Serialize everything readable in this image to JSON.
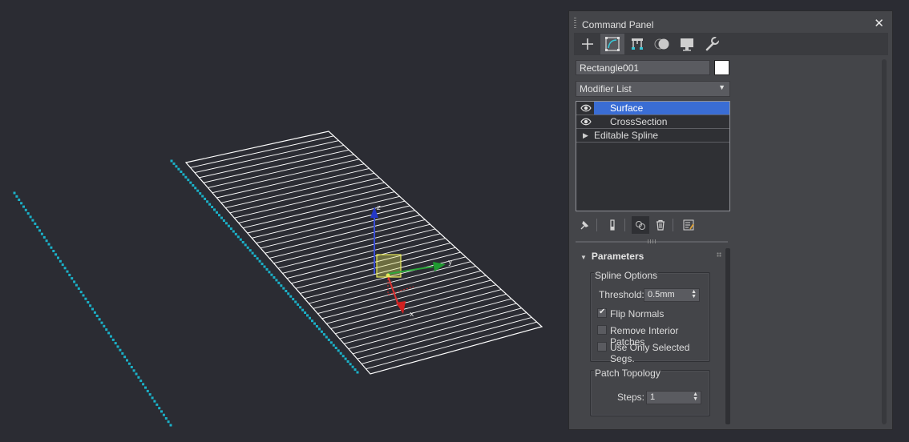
{
  "panel": {
    "title": "Command Panel",
    "close_glyph": "✕",
    "tabs": [
      {
        "name": "create-tab",
        "icon": "plus-icon"
      },
      {
        "name": "modify-tab",
        "icon": "modify-curve-icon",
        "active": true
      },
      {
        "name": "hierarchy-tab",
        "icon": "hierarchy-icon"
      },
      {
        "name": "motion-tab",
        "icon": "motion-sphere-icon"
      },
      {
        "name": "display-tab",
        "icon": "display-monitor-icon"
      },
      {
        "name": "utilities-tab",
        "icon": "wrench-icon"
      }
    ],
    "object_name": "Rectangle001",
    "object_color": "#ffffff",
    "modifier_list_label": "Modifier List",
    "stack": [
      {
        "label": "Surface",
        "visible": true,
        "selected": true
      },
      {
        "label": "CrossSection",
        "visible": true,
        "selected": false
      },
      {
        "label": "Editable Spline",
        "expandable": true,
        "selected": false
      }
    ],
    "stack_tools": [
      "pin-stack-icon",
      "show-end-result-icon",
      "make-unique-icon",
      "remove-modifier-icon",
      "configure-modifier-sets-icon"
    ]
  },
  "parameters": {
    "title": "Parameters",
    "spline_options": {
      "label": "Spline Options",
      "threshold_label": "Threshold:",
      "threshold_value": "0.5mm",
      "flip_normals": {
        "label": "Flip Normals",
        "checked": true
      },
      "remove_interior": {
        "label": "Remove Interior Patches",
        "checked": false
      },
      "use_selected": {
        "label": "Use Only Selected Segs.",
        "checked": false
      }
    },
    "patch_topology": {
      "label": "Patch Topology",
      "steps_label": "Steps:",
      "steps_value": "1"
    }
  },
  "viewport": {
    "background": "#2b2c33",
    "spline_color": "#1bb1c8",
    "surface_color": "#ffffff",
    "gizmo_axes": [
      "z",
      "y",
      "x"
    ]
  }
}
